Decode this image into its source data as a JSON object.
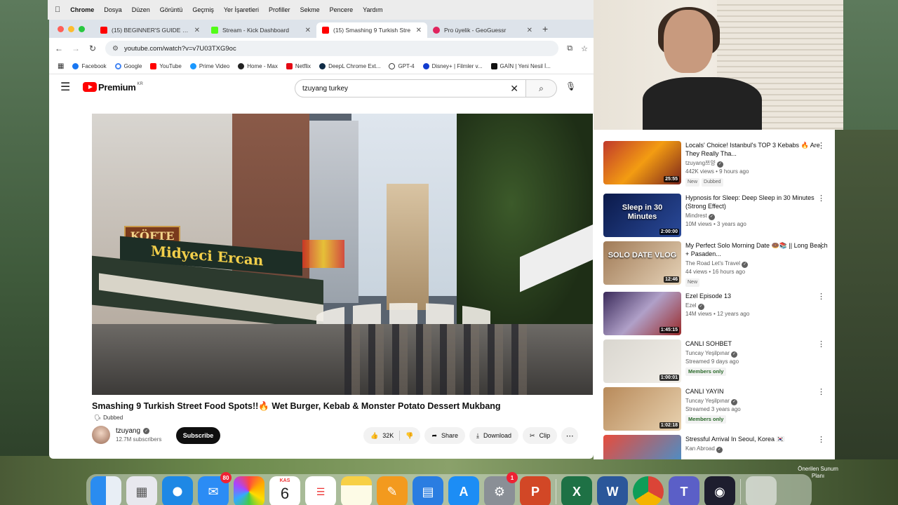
{
  "menubar": {
    "apple": "",
    "items": [
      "Chrome",
      "Dosya",
      "Düzen",
      "Görüntü",
      "Geçmiş",
      "Yer İşaretleri",
      "Profiller",
      "Sekme",
      "Pencere",
      "Yardım"
    ]
  },
  "tabs": [
    {
      "title": "(15) BEGINNER'S GUIDE to D",
      "favicon_color": "#ff0000"
    },
    {
      "title": "Stream - Kick Dashboard",
      "favicon_color": "#53fc18"
    },
    {
      "title": "(15) Smashing 9 Turkish Stre",
      "favicon_color": "#ff0000"
    },
    {
      "title": "Pro üyelik - GeoGuessr",
      "favicon_color": "#e0245e"
    }
  ],
  "address_bar": {
    "url": "youtube.com/watch?v=v7U03TXG9oc"
  },
  "bookmarks": [
    "Facebook",
    "Google",
    "YouTube",
    "Prime Video",
    "Home - Max",
    "Netflix",
    "DeepL Chrome Ext...",
    "GPT-4",
    "Disney+ | Filmler v...",
    "GAİN | Yeni Nesil İ..."
  ],
  "youtube": {
    "logo_text": "Premium",
    "logo_region": "KR",
    "search_query": "tzuyang turkey",
    "video_overlay_sign1": "KÖFTE",
    "video_overlay_sign2": "Midyeci Ercan",
    "video_title": "Smashing 9 Turkish Street Food Spots!!🔥 Wet Burger, Kebab & Monster Potato Dessert Mukbang",
    "dubbed_label": "Dubbed",
    "channel_name": "tzuyang",
    "subscribers": "12.7M subscribers",
    "subscribe_label": "Subscribe",
    "like_count": "32K",
    "share_label": "Share",
    "download_label": "Download",
    "clip_label": "Clip"
  },
  "recommendations": [
    {
      "title": "Locals' Choice! Istanbul's TOP 3 Kebabs 🔥 Are They Really Tha...",
      "channel": "tzuyang쯔양",
      "meta": "442K views • 9 hours ago",
      "duration": "25:55",
      "tags": [
        "New",
        "Dubbed"
      ],
      "thumb": "linear-gradient(135deg,#c0392b,#f39c12,#7b241c)"
    },
    {
      "title": "Hypnosis for Sleep: Deep Sleep in 30 Minutes (Strong Effect)",
      "channel": "Mindrest",
      "meta": "10M views • 3 years ago",
      "duration": "2:00:00",
      "tags": [],
      "thumb_text": "Sleep in 30 Minutes",
      "thumb": "linear-gradient(135deg,#0b1a4a,#2a4a9a)"
    },
    {
      "title": "My Perfect Solo Morning Date 🍩📚 || Long Beach + Pasaden...",
      "channel": "The Road Let's Travel",
      "meta": "44 views • 16 hours ago",
      "duration": "12:46",
      "tags": [
        "New"
      ],
      "thumb_text": "SOLO DATE VLOG",
      "thumb": "linear-gradient(135deg,#a07a56,#e6d3b8)"
    },
    {
      "title": "Ezel Episode 13",
      "channel": "Ezel",
      "meta": "14M views • 12 years ago",
      "duration": "1:45:15",
      "tags": [],
      "thumb": "linear-gradient(135deg,#3a2a5a,#b0a0c8,#9a2a2a)"
    },
    {
      "title": "CANLI SOHBET",
      "channel": "Tuncay Yeşilpınar",
      "meta": "Streamed 9 days ago",
      "duration": "1:00:01",
      "tags": [],
      "members": "Members only",
      "thumb": "linear-gradient(135deg,#d9d6cf,#f2efe9)"
    },
    {
      "title": "CANLI YAYIN",
      "channel": "Tuncay Yeşilpınar",
      "meta": "Streamed 3 years ago",
      "duration": "1:02:18",
      "tags": [],
      "members": "Members only",
      "thumb": "linear-gradient(135deg,#b88a5a,#e8d2b0)"
    },
    {
      "title": "Stressful Arrival In Seoul, Korea 🇰🇷",
      "channel": "Kan Abroad",
      "meta": "",
      "duration": "",
      "tags": [],
      "thumb": "linear-gradient(135deg,#e74c3c,#3498db)"
    }
  ],
  "desktop": {
    "label": "Önerilen Sunum Planı"
  },
  "dock": {
    "mail_badge": "80",
    "calendar_month": "KAS",
    "calendar_day": "6",
    "settings_badge": "1"
  }
}
